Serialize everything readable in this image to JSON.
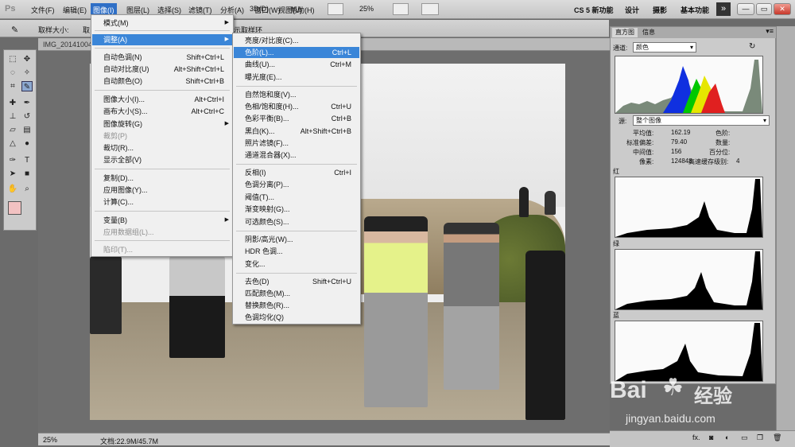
{
  "app": {
    "logo": "Ps",
    "workspace": "CS 5 新功能",
    "zoom": "25%",
    "title_right": [
      "设计",
      "摄影",
      "基本功能"
    ],
    "more": "»",
    "window_buttons": [
      "—",
      "▭",
      "✕"
    ]
  },
  "menubar": [
    {
      "label": "文件(F)"
    },
    {
      "label": "编辑(E)"
    },
    {
      "label": "图像(I)"
    },
    {
      "label": "图层(L)"
    },
    {
      "label": "选择(S)"
    },
    {
      "label": "滤镜(T)"
    },
    {
      "label": "分析(A)"
    },
    {
      "label": "3D(D)"
    },
    {
      "label": "视图(V)"
    },
    {
      "label": "窗口(W)"
    },
    {
      "label": "帮助(H)"
    }
  ],
  "options": {
    "sample_label": "取样大小:",
    "sample_value": "取",
    "ring_label": "示取样环"
  },
  "document": {
    "tab_title": "IMG_20141004",
    "zoom_status": "25%",
    "doc_info": "文档:22.9M/45.7M"
  },
  "image_menu": {
    "items": [
      {
        "label": "模式(M)",
        "arrow": "▶"
      },
      {
        "label": "调整(A)",
        "arrow": "▶"
      },
      {
        "label": "自动色调(N)",
        "shortcut": "Shift+Ctrl+L"
      },
      {
        "label": "自动对比度(U)",
        "shortcut": "Alt+Shift+Ctrl+L"
      },
      {
        "label": "自动颜色(O)",
        "shortcut": "Shift+Ctrl+B"
      },
      {
        "label": "图像大小(I)...",
        "shortcut": "Alt+Ctrl+I"
      },
      {
        "label": "画布大小(S)...",
        "shortcut": "Alt+Ctrl+C"
      },
      {
        "label": "图像旋转(G)",
        "arrow": "▶"
      },
      {
        "label": "裁剪(P)"
      },
      {
        "label": "裁切(R)..."
      },
      {
        "label": "显示全部(V)"
      },
      {
        "label": "复制(D)..."
      },
      {
        "label": "应用图像(Y)..."
      },
      {
        "label": "计算(C)..."
      },
      {
        "label": "变量(B)",
        "arrow": "▶"
      },
      {
        "label": "应用数据组(L)..."
      },
      {
        "label": "陷印(T)..."
      }
    ]
  },
  "adjust_menu": {
    "items": [
      {
        "label": "亮度/对比度(C)..."
      },
      {
        "label": "色阶(L)...",
        "shortcut": "Ctrl+L"
      },
      {
        "label": "曲线(U)...",
        "shortcut": "Ctrl+M"
      },
      {
        "label": "曝光度(E)..."
      },
      {
        "label": "自然饱和度(V)..."
      },
      {
        "label": "色相/饱和度(H)...",
        "shortcut": "Ctrl+U"
      },
      {
        "label": "色彩平衡(B)...",
        "shortcut": "Ctrl+B"
      },
      {
        "label": "黑白(K)...",
        "shortcut": "Alt+Shift+Ctrl+B"
      },
      {
        "label": "照片滤镜(F)..."
      },
      {
        "label": "通道混合器(X)..."
      },
      {
        "label": "反相(I)",
        "shortcut": "Ctrl+I"
      },
      {
        "label": "色调分离(P)..."
      },
      {
        "label": "阈值(T)..."
      },
      {
        "label": "渐变映射(G)..."
      },
      {
        "label": "可选颜色(S)..."
      },
      {
        "label": "阴影/高光(W)..."
      },
      {
        "label": "HDR 色调..."
      },
      {
        "label": "变化..."
      },
      {
        "label": "去色(D)",
        "shortcut": "Shift+Ctrl+U"
      },
      {
        "label": "匹配颜色(M)..."
      },
      {
        "label": "替换颜色(R)..."
      },
      {
        "label": "色调均化(Q)"
      }
    ]
  },
  "histogram": {
    "tabs": [
      "直方图",
      "信息"
    ],
    "channel_label": "通道:",
    "channel_value": "颜色",
    "source_label": "源:",
    "source_value": "整个图像",
    "stats": [
      {
        "label": "平均值:",
        "value": "162.19"
      },
      {
        "label": "标准偏差:",
        "value": "79.40"
      },
      {
        "label": "中间值:",
        "value": "156"
      },
      {
        "label": "像素:",
        "value": "124848"
      }
    ],
    "stats_right": [
      {
        "label": "色阶:",
        "value": ""
      },
      {
        "label": "数量:",
        "value": ""
      },
      {
        "label": "百分位:",
        "value": ""
      },
      {
        "label": "高速缓存级别:",
        "value": "4"
      }
    ],
    "channels": [
      "红",
      "绿",
      "蓝"
    ]
  },
  "watermark": {
    "brand": "Bai",
    "brand2": "经验",
    "url": "jingyan.baidu.com"
  },
  "colors": {
    "menu_highlight": "#3b86d8",
    "fg_swatch": "#f2c2c2",
    "bg_swatch": "#e00000"
  }
}
